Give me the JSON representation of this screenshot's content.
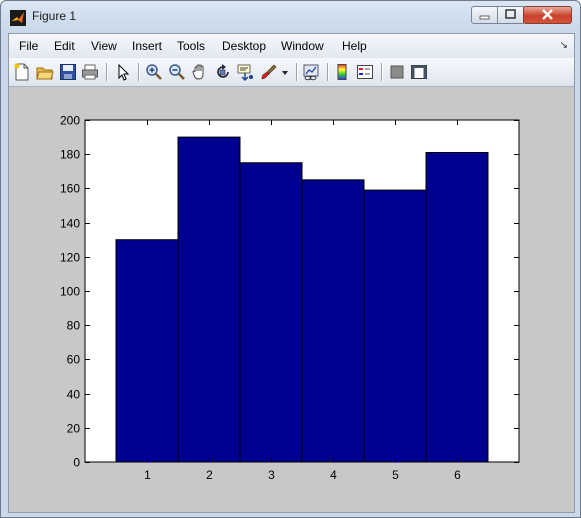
{
  "window": {
    "title": "Figure 1"
  },
  "menu": [
    "File",
    "Edit",
    "View",
    "Insert",
    "Tools",
    "Desktop",
    "Window",
    "Help"
  ],
  "toolbar": [
    "new-figure-icon",
    "open-file-icon",
    "save-icon",
    "print-icon",
    "edit-plot-arrow-icon",
    "zoom-in-icon",
    "zoom-out-icon",
    "pan-hand-icon",
    "rotate-3d-icon",
    "data-cursor-icon",
    "brush-icon",
    "link-plot-icon",
    "colorbar-icon",
    "legend-icon",
    "hide-plot-tools-icon",
    "show-plot-tools-icon"
  ],
  "chart_data": {
    "type": "bar",
    "categories": [
      "1",
      "2",
      "3",
      "4",
      "5",
      "6"
    ],
    "values": [
      130,
      190,
      175,
      165,
      159,
      181
    ],
    "title": "",
    "xlabel": "",
    "ylabel": "",
    "ylim": [
      0,
      200
    ],
    "yticks": [
      0,
      20,
      40,
      60,
      80,
      100,
      120,
      140,
      160,
      180,
      200
    ],
    "bar_color": "#000090",
    "grid": false
  }
}
